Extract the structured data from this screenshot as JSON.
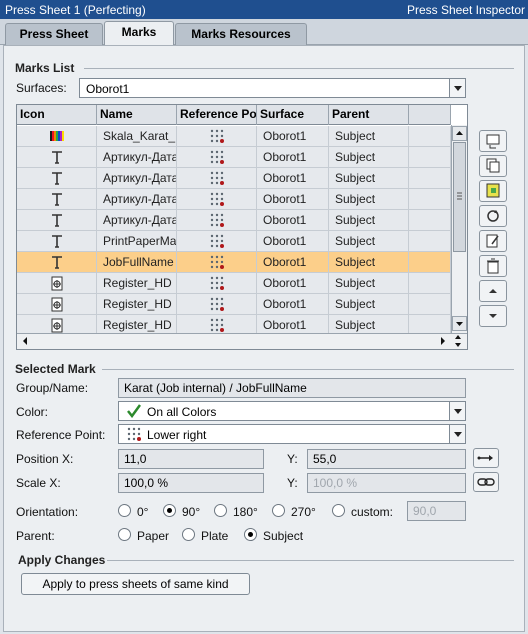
{
  "titlebar": {
    "left": "Press Sheet 1 (Perfecting)",
    "right": "Press Sheet Inspector"
  },
  "tabs": [
    {
      "label": "Press Sheet",
      "active": false
    },
    {
      "label": "Marks",
      "active": true
    },
    {
      "label": "Marks Resources",
      "active": false
    }
  ],
  "marks_list": {
    "title": "Marks List",
    "surfaces_label": "Surfaces:",
    "surfaces_value": "Oborot1",
    "columns": [
      "Icon",
      "Name",
      "Reference Po",
      "Surface",
      "Parent"
    ],
    "rows": [
      {
        "icon": "color-bar-icon",
        "name": "Skala_Karat_",
        "surface": "Oborot1",
        "parent": "Subject",
        "selected": false
      },
      {
        "icon": "text-icon",
        "name": "Артикул-Дата",
        "surface": "Oborot1",
        "parent": "Subject",
        "selected": false
      },
      {
        "icon": "text-icon",
        "name": "Артикул-Дата",
        "surface": "Oborot1",
        "parent": "Subject",
        "selected": false
      },
      {
        "icon": "text-icon",
        "name": "Артикул-Дата",
        "surface": "Oborot1",
        "parent": "Subject",
        "selected": false
      },
      {
        "icon": "text-icon",
        "name": "Артикул-Дата",
        "surface": "Oborot1",
        "parent": "Subject",
        "selected": false
      },
      {
        "icon": "text-icon",
        "name": "PrintPaperMa",
        "surface": "Oborot1",
        "parent": "Subject",
        "selected": false
      },
      {
        "icon": "text-icon",
        "name": "JobFullName",
        "surface": "Oborot1",
        "parent": "Subject",
        "selected": true
      },
      {
        "icon": "register-mark-icon",
        "name": "Register_HD",
        "surface": "Oborot1",
        "parent": "Subject",
        "selected": false
      },
      {
        "icon": "register-mark-icon",
        "name": "Register_HD",
        "surface": "Oborot1",
        "parent": "Subject",
        "selected": false
      },
      {
        "icon": "register-mark-icon",
        "name": "Register_HD",
        "surface": "Oborot1",
        "parent": "Subject",
        "selected": false
      }
    ]
  },
  "side_buttons": [
    "new-mark-icon",
    "duplicate-icon",
    "import-icon",
    "refresh-icon",
    "edit-icon",
    "delete-icon",
    "move-up-icon",
    "move-down-icon"
  ],
  "selected_mark": {
    "title": "Selected Mark",
    "group_label": "Group/Name:",
    "group_value": "Karat (Job internal) / JobFullName",
    "color_label": "Color:",
    "color_value": "On all Colors",
    "refpoint_label": "Reference Point:",
    "refpoint_value": "Lower right",
    "posx_label": "Position X:",
    "posx_value": "11,0",
    "posy_label": "Y:",
    "posy_value": "55,0",
    "scalex_label": "Scale X:",
    "scalex_value": "100,0 %",
    "scaley_label": "Y:",
    "scaley_value": "100,0 %",
    "orientation_label": "Orientation:",
    "orientation_options": [
      "0°",
      "90°",
      "180°",
      "270°",
      "custom:"
    ],
    "orientation_selected": "90°",
    "custom_value": "90,0",
    "parent_label": "Parent:",
    "parent_options": [
      "Paper",
      "Plate",
      "Subject"
    ],
    "parent_selected": "Subject"
  },
  "apply": {
    "title": "Apply Changes",
    "button": "Apply to press sheets of same kind"
  },
  "colors": {
    "titlebar": "#1f4f8f",
    "selected_row": "#fccf8a",
    "panel": "#eceff2"
  }
}
